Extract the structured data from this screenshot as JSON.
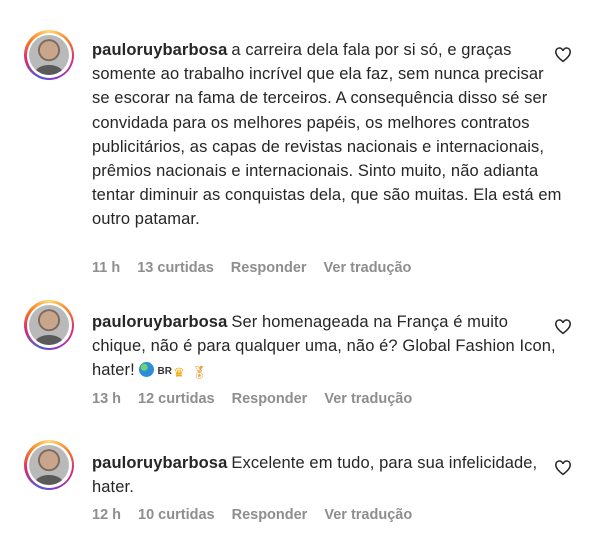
{
  "comments": [
    {
      "username": "pauloruybarbosa",
      "text": "a carreira dela fala por si só, e graças somente ao trabalho incrível que ela faz, sem nunca precisar se escorar na fama de terceiros. A consequência disso sé ser convidada para os melhores papéis, os melhores contratos publicitários, as capas de revistas nacionais e internacionais, prêmios nacionais e internacionais. Sinto muito, não adianta tentar diminuir as conquistas dela, que são muitas. Ela está em outro patamar.",
      "time": "11 h",
      "likes": "13 curtidas",
      "reply": "Responder",
      "translate": "Ver tradução"
    },
    {
      "username": "pauloruybarbosa",
      "text": "Ser homenageada na França é muito chique, não é para qualquer uma, não é? Global Fashion Icon, hater!",
      "emoji_br": "BR",
      "time": "13 h",
      "likes": "12 curtidas",
      "reply": "Responder",
      "translate": "Ver tradução"
    },
    {
      "username": "pauloruybarbosa",
      "text": "Excelente em tudo, para sua infelicidade, hater.",
      "time": "12 h",
      "likes": "10 curtidas",
      "reply": "Responder",
      "translate": "Ver tradução"
    }
  ],
  "icons": {
    "like": "heart-outline-icon",
    "avatar_ring": "story-ring"
  },
  "colors": {
    "text": "#262626",
    "meta": "#8e8e8e"
  }
}
